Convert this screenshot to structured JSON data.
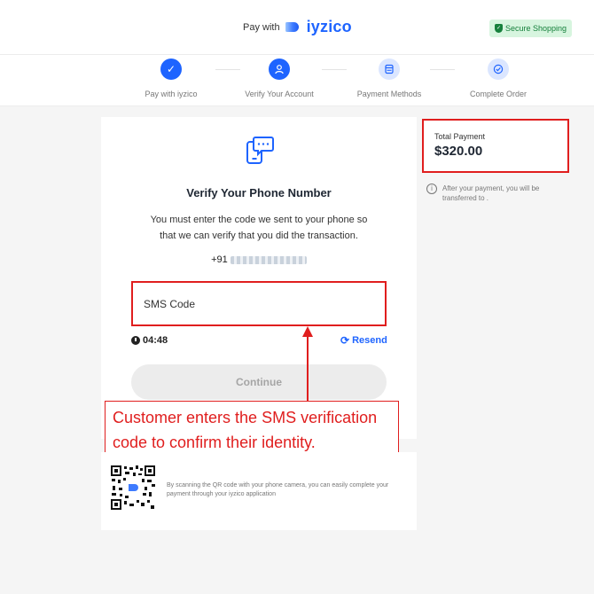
{
  "header": {
    "brand_prefix": "Pay with",
    "brand_name": "iyzico",
    "secure_label": "Secure Shopping"
  },
  "steps": [
    {
      "label": "Pay with iyzico",
      "state": "done",
      "icon": "check-icon"
    },
    {
      "label": "Verify Your Account",
      "state": "active",
      "icon": "user-icon"
    },
    {
      "label": "Payment Methods",
      "state": "pending",
      "icon": "card-icon"
    },
    {
      "label": "Complete Order",
      "state": "pending",
      "icon": "check-circle-icon"
    }
  ],
  "verify": {
    "title": "Verify Your Phone Number",
    "description": "You must enter the code we sent to your phone so that we can verify that you did the transaction.",
    "phone_prefix": "+91",
    "sms_placeholder": "SMS Code",
    "timer": "04:48",
    "resend_label": "Resend",
    "continue_label": "Continue"
  },
  "annotation": {
    "text": "Customer enters the SMS verification code to confirm their identity."
  },
  "qr": {
    "text": "By scanning the QR code with your phone camera, you can easily complete your payment through your iyzico application"
  },
  "summary": {
    "total_label": "Total Payment",
    "total_amount": "$320.00",
    "info": "After your payment, you will be transferred to ."
  },
  "colors": {
    "brand": "#1e64ff",
    "highlight": "#e01e1e",
    "secure_bg": "#d7f5df",
    "secure_text": "#16803c"
  }
}
